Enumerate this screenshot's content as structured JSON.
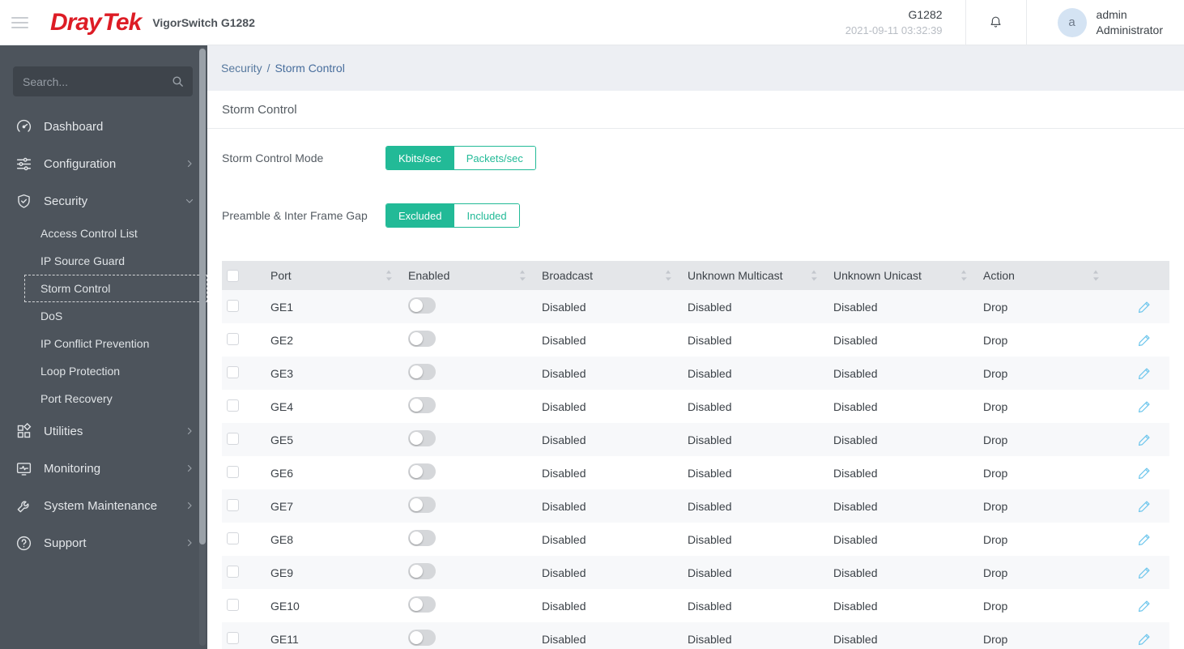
{
  "header": {
    "brand": {
      "part1": "Dray",
      "part2": "Tek"
    },
    "product": "VigorSwitch G1282",
    "device_name": "G1282",
    "datetime": "2021-09-11 03:32:39",
    "icons": [
      "hamburger-icon",
      "bell-icon"
    ],
    "user": {
      "avatar_letter": "a",
      "username": "admin",
      "role": "Administrator"
    }
  },
  "sidebar": {
    "search_placeholder": "Search...",
    "items": [
      {
        "label": "Dashboard",
        "icon": "gauge-icon",
        "chevron": null
      },
      {
        "label": "Configuration",
        "icon": "sliders-icon",
        "chevron": "right"
      },
      {
        "label": "Security",
        "icon": "shield-check-icon",
        "chevron": "down",
        "children": [
          "Access Control List",
          "IP Source Guard",
          "Storm Control",
          "DoS",
          "IP Conflict Prevention",
          "Loop Protection",
          "Port Recovery"
        ],
        "selected_child": "Storm Control"
      },
      {
        "label": "Utilities",
        "icon": "grid-icon",
        "chevron": "right"
      },
      {
        "label": "Monitoring",
        "icon": "monitor-icon",
        "chevron": "right"
      },
      {
        "label": "System Maintenance",
        "icon": "wrench-icon",
        "chevron": "right"
      },
      {
        "label": "Support",
        "icon": "question-icon",
        "chevron": "right"
      }
    ]
  },
  "breadcrumb": {
    "parent": "Security",
    "separator": "/",
    "current": "Storm Control"
  },
  "page": {
    "title": "Storm Control",
    "form": [
      {
        "label": "Storm Control Mode",
        "options": [
          "Kbits/sec",
          "Packets/sec"
        ],
        "selected": "Kbits/sec"
      },
      {
        "label": "Preamble & Inter Frame Gap",
        "options": [
          "Excluded",
          "Included"
        ],
        "selected": "Excluded"
      }
    ]
  },
  "table": {
    "columns": [
      "Port",
      "Enabled",
      "Broadcast",
      "Unknown Multicast",
      "Unknown Unicast",
      "Action"
    ],
    "row_icons": [
      "toggle-off",
      "edit-icon"
    ],
    "rows": [
      {
        "port": "GE1",
        "enabled": false,
        "broadcast": "Disabled",
        "unknown_multicast": "Disabled",
        "unknown_unicast": "Disabled",
        "action": "Drop"
      },
      {
        "port": "GE2",
        "enabled": false,
        "broadcast": "Disabled",
        "unknown_multicast": "Disabled",
        "unknown_unicast": "Disabled",
        "action": "Drop"
      },
      {
        "port": "GE3",
        "enabled": false,
        "broadcast": "Disabled",
        "unknown_multicast": "Disabled",
        "unknown_unicast": "Disabled",
        "action": "Drop"
      },
      {
        "port": "GE4",
        "enabled": false,
        "broadcast": "Disabled",
        "unknown_multicast": "Disabled",
        "unknown_unicast": "Disabled",
        "action": "Drop"
      },
      {
        "port": "GE5",
        "enabled": false,
        "broadcast": "Disabled",
        "unknown_multicast": "Disabled",
        "unknown_unicast": "Disabled",
        "action": "Drop"
      },
      {
        "port": "GE6",
        "enabled": false,
        "broadcast": "Disabled",
        "unknown_multicast": "Disabled",
        "unknown_unicast": "Disabled",
        "action": "Drop"
      },
      {
        "port": "GE7",
        "enabled": false,
        "broadcast": "Disabled",
        "unknown_multicast": "Disabled",
        "unknown_unicast": "Disabled",
        "action": "Drop"
      },
      {
        "port": "GE8",
        "enabled": false,
        "broadcast": "Disabled",
        "unknown_multicast": "Disabled",
        "unknown_unicast": "Disabled",
        "action": "Drop"
      },
      {
        "port": "GE9",
        "enabled": false,
        "broadcast": "Disabled",
        "unknown_multicast": "Disabled",
        "unknown_unicast": "Disabled",
        "action": "Drop"
      },
      {
        "port": "GE10",
        "enabled": false,
        "broadcast": "Disabled",
        "unknown_multicast": "Disabled",
        "unknown_unicast": "Disabled",
        "action": "Drop"
      },
      {
        "port": "GE11",
        "enabled": false,
        "broadcast": "Disabled",
        "unknown_multicast": "Disabled",
        "unknown_unicast": "Disabled",
        "action": "Drop"
      }
    ]
  },
  "colors": {
    "accent_green": "#22ba97",
    "brand_red": "#dd1c25",
    "edit_blue": "#6bc5ec",
    "sidebar_bg": "#4d545c"
  }
}
